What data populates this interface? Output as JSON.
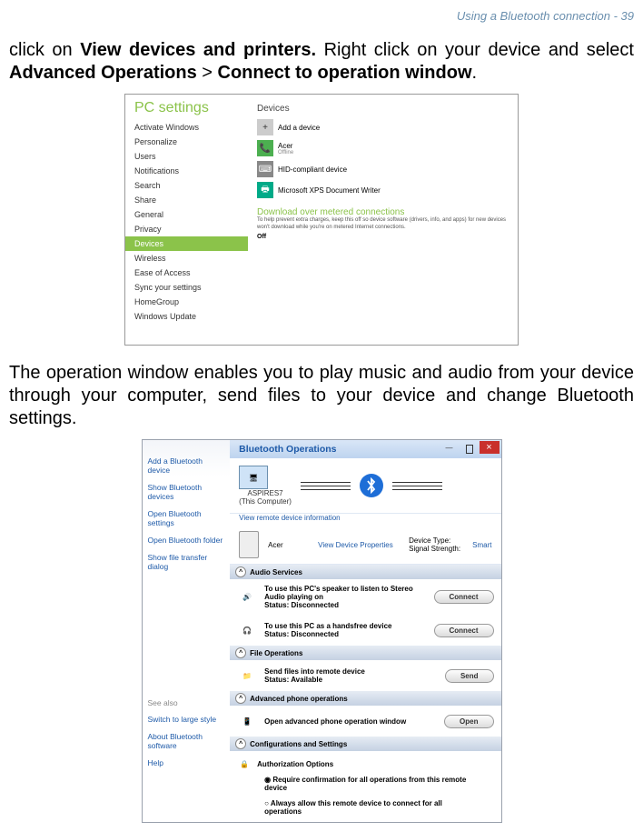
{
  "header": "Using a Bluetooth connection - 39",
  "para1_pre": "click on ",
  "para1_b1": "View devices and printers.",
  "para1_mid": " Right click on your device and select ",
  "para1_b2": "Advanced Operations",
  "para1_gt": " > ",
  "para1_b3": "Connect to operation window",
  "para1_end": ".",
  "para2": "The operation window enables you to play music and audio from your device through your computer, send files to your device and change Bluetooth settings.",
  "shot1": {
    "title": "PC settings",
    "items": [
      "Activate Windows",
      "Personalize",
      "Users",
      "Notifications",
      "Search",
      "Share",
      "General",
      "Privacy",
      "Devices",
      "Wireless",
      "Ease of Access",
      "Sync your settings",
      "HomeGroup",
      "Windows Update"
    ],
    "selected_index": 8,
    "devices_label": "Devices",
    "add": "Add a device",
    "dev1": {
      "name": "Acer",
      "sub": "Offline"
    },
    "dev2": {
      "name": "HID-compliant device",
      "sub": ""
    },
    "dev3": {
      "name": "Microsoft XPS Document Writer",
      "sub": ""
    },
    "sect2": "Download over metered connections",
    "note": "To help prevent extra charges, keep this off so device software (drivers, info, and apps) for new devices won't download while you're on metered Internet connections.",
    "off": "Off"
  },
  "shot2": {
    "side_items": [
      "Add a Bluetooth device",
      "Show Bluetooth devices",
      "Open Bluetooth settings",
      "Open Bluetooth folder",
      "Show file transfer dialog"
    ],
    "seealso_label": "See also",
    "seealso_items": [
      "Switch to large style",
      "About Bluetooth software",
      "Help"
    ],
    "headline": "Bluetooth Operations",
    "comp_name": "ASPIRES7",
    "comp_sub": "(This Computer)",
    "view_remote": "View remote device information",
    "remote_name": "Acer",
    "view_props": "View Device Properties",
    "dev_type_label": "Device Type:",
    "dev_type": "Smart",
    "signal_label": "Signal Strength:",
    "sec_audio": "Audio Services",
    "audio1_t": "To use this PC's speaker to listen to Stereo Audio playing on",
    "audio1_s": "Status:   Disconnected",
    "audio2_t": "To use this PC as a handsfree device",
    "audio2_s": "Status:   Disconnected",
    "btn_connect": "Connect",
    "sec_file": "File Operations",
    "file_t": "Send files into remote device",
    "file_s": "Status:   Available",
    "btn_send": "Send",
    "sec_phone": "Advanced phone operations",
    "phone_t": "Open advanced phone operation window",
    "btn_open": "Open",
    "sec_conf": "Configurations and Settings",
    "auth_t": "Authorization Options",
    "radio1": "Require confirmation for all operations from this remote device",
    "radio2": "Always allow this remote device to connect for all operations"
  }
}
